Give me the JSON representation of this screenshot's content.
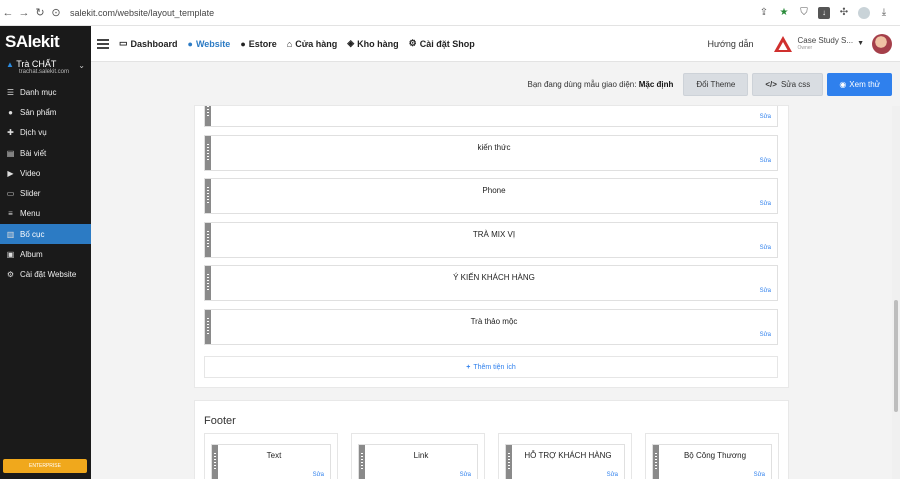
{
  "browser": {
    "url": "salekit.com/website/layout_template"
  },
  "brand": {
    "logo": "SAlekit"
  },
  "store": {
    "name": "Trà CHẤT",
    "url": "trachat.salekit.com"
  },
  "sidebar": {
    "items": [
      {
        "label": "Danh mục",
        "icon": "list-icon"
      },
      {
        "label": "Sản phẩm",
        "icon": "product-icon"
      },
      {
        "label": "Dịch vụ",
        "icon": "service-icon"
      },
      {
        "label": "Bài viết",
        "icon": "article-icon"
      },
      {
        "label": "Video",
        "icon": "video-icon"
      },
      {
        "label": "Slider",
        "icon": "slider-icon"
      },
      {
        "label": "Menu",
        "icon": "menu-icon"
      },
      {
        "label": "Bố cục",
        "icon": "layout-icon",
        "active": true
      },
      {
        "label": "Album",
        "icon": "album-icon"
      },
      {
        "label": "Cài đặt Website",
        "icon": "gear-icon"
      }
    ],
    "enterprise": "ENTERPRISE"
  },
  "topnav": {
    "links": [
      {
        "label": "Dashboard",
        "icon": "monitor-icon"
      },
      {
        "label": "Website",
        "icon": "globe-icon",
        "active": true
      },
      {
        "label": "Estore",
        "icon": "globe-icon"
      },
      {
        "label": "Cửa hàng",
        "icon": "store-icon"
      },
      {
        "label": "Kho hàng",
        "icon": "stack-icon"
      },
      {
        "label": "Cài đặt Shop",
        "icon": "gear-icon"
      }
    ],
    "help": "Hướng dẫn",
    "company": {
      "name": "Case Study S...",
      "role": "Owner"
    }
  },
  "toolbar": {
    "template_text": "Bạn đang dùng mẫu giao diện:",
    "template_name": "Mặc định",
    "change_theme": "Đổi Theme",
    "edit_css": "Sửa css",
    "preview": "Xem thử"
  },
  "widgets": [
    {
      "title": "",
      "edit": "Sửa"
    },
    {
      "title": "kiến thức",
      "edit": "Sửa"
    },
    {
      "title": "Phone",
      "edit": "Sửa"
    },
    {
      "title": "TRÀ MIX VỊ",
      "edit": "Sửa"
    },
    {
      "title": "Ý KIẾN KHÁCH HÀNG",
      "edit": "Sửa"
    },
    {
      "title": "Trà thảo mộc",
      "edit": "Sửa"
    }
  ],
  "add_widget": "Thêm tiện ích",
  "footer": {
    "title": "Footer",
    "columns": [
      {
        "title": "Text",
        "edit": "Sửa"
      },
      {
        "title": "Link",
        "edit": "Sửa"
      },
      {
        "title": "HỖ TRỢ KHÁCH HÀNG",
        "edit": "Sửa"
      },
      {
        "title": "Bộ Công Thương",
        "edit": "Sửa"
      }
    ]
  },
  "colors": {
    "accent": "#2f80ed",
    "sidebar_bg": "#1a1a1a",
    "sidebar_active": "#2c7bc4",
    "enterprise": "#f0a81c"
  }
}
